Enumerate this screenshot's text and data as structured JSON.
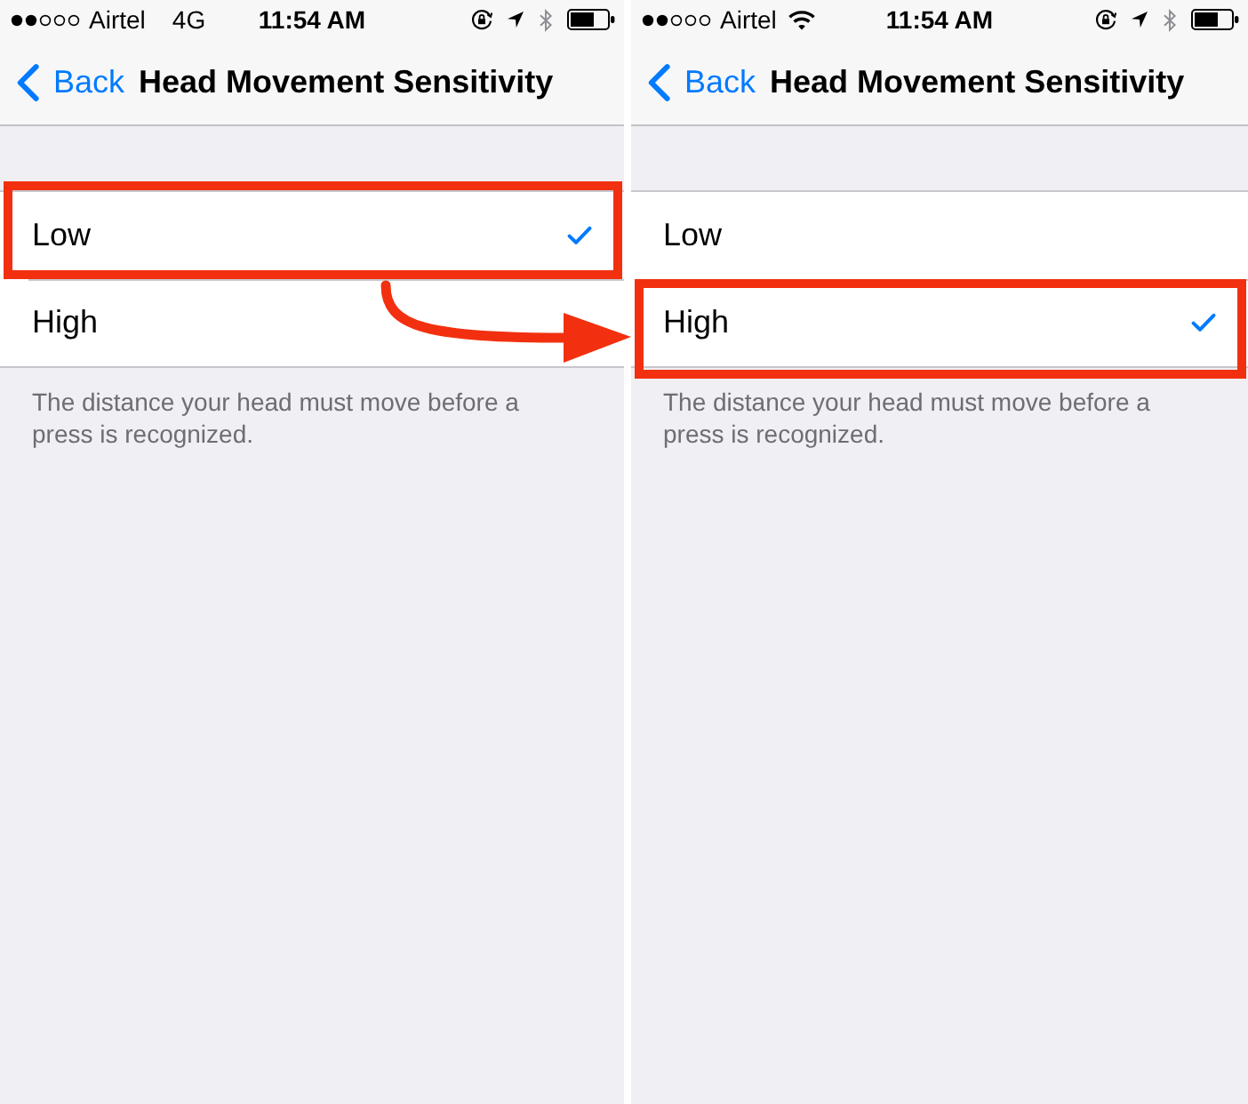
{
  "panels": [
    {
      "status_bar": {
        "carrier": "Airtel",
        "network": {
          "kind": "cellular",
          "label": "4G"
        },
        "time": "11:54 AM"
      },
      "nav": {
        "back": "Back",
        "title": "Head Movement Sensitivity"
      },
      "options": [
        {
          "label": "Low",
          "selected": true,
          "highlighted": true
        },
        {
          "label": "High",
          "selected": false,
          "highlighted": false
        }
      ],
      "footer": "The distance your head must move before a press is recognized."
    },
    {
      "status_bar": {
        "carrier": "Airtel",
        "network": {
          "kind": "wifi"
        },
        "time": "11:54 AM"
      },
      "nav": {
        "back": "Back",
        "title": "Head Movement Sensitivity"
      },
      "options": [
        {
          "label": "Low",
          "selected": false,
          "highlighted": false
        },
        {
          "label": "High",
          "selected": true,
          "highlighted": true
        }
      ],
      "footer": "The distance your head must move before a press is recognized."
    }
  ]
}
